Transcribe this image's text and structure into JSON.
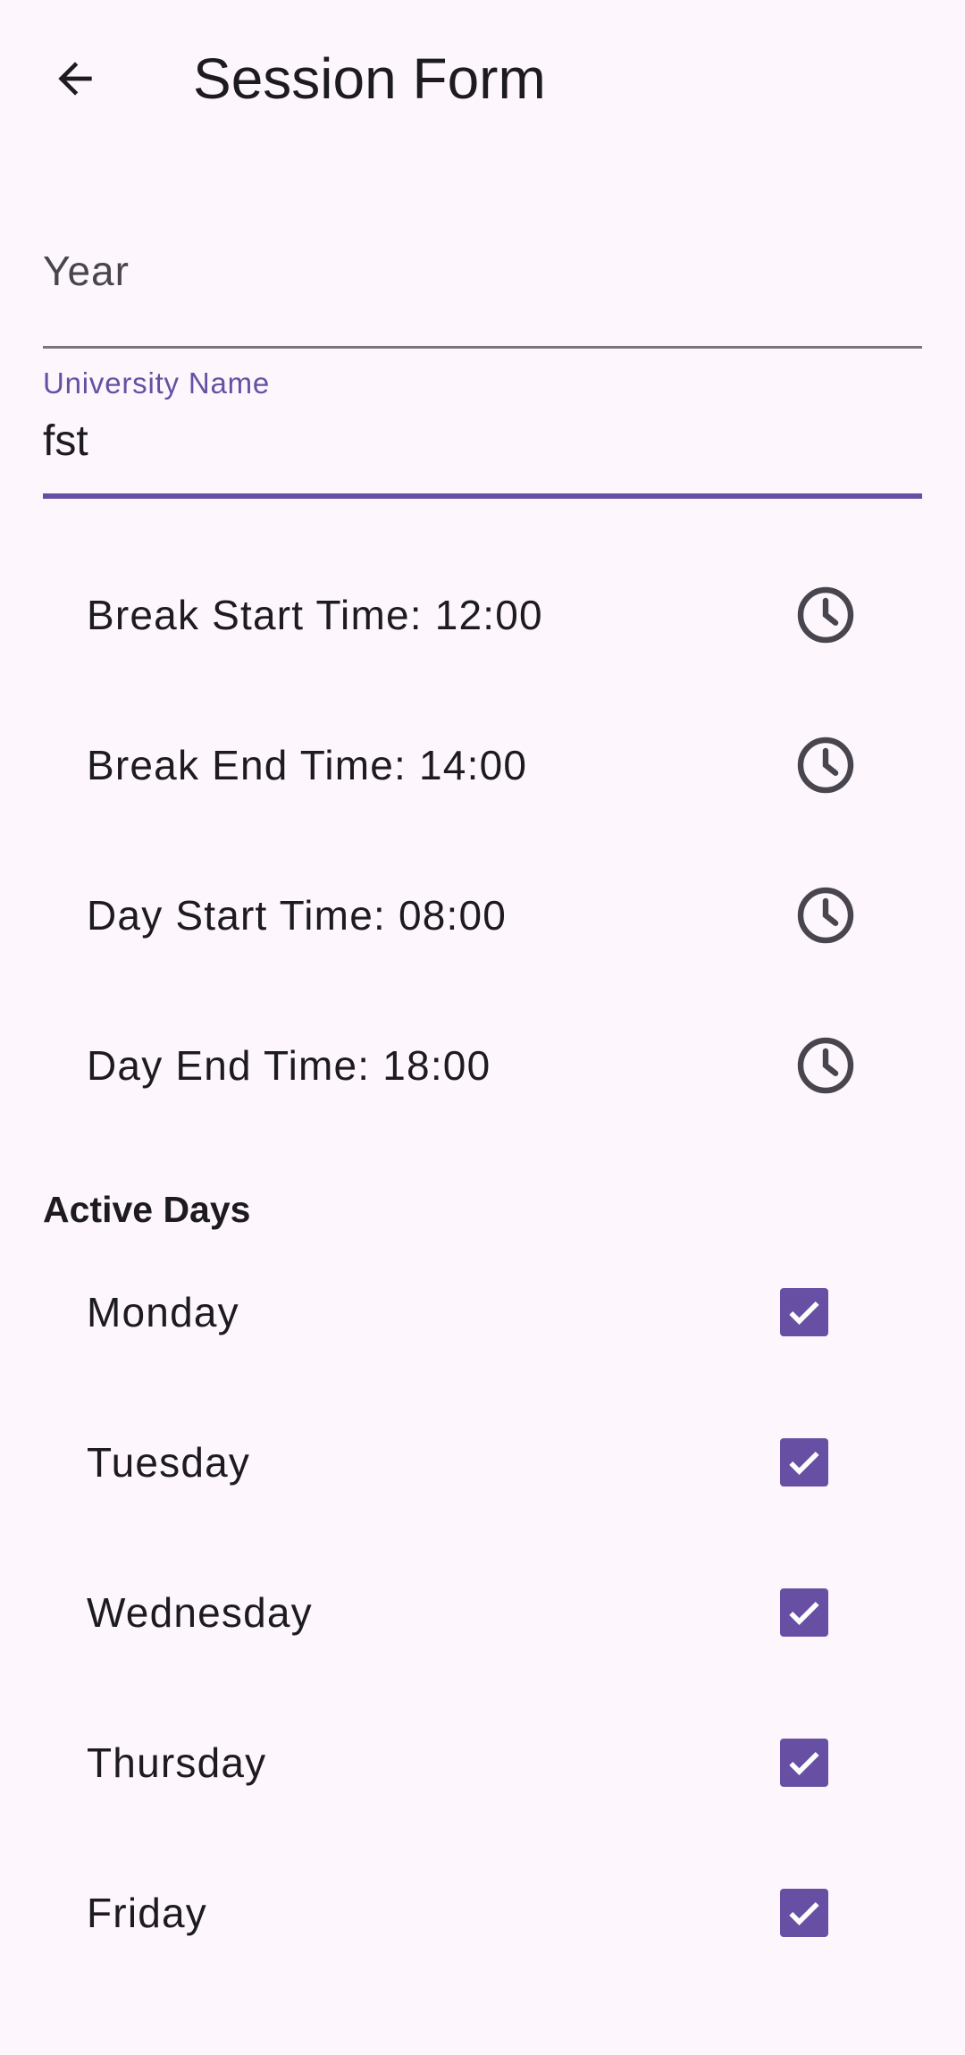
{
  "appbar": {
    "title": "Session Form",
    "back_icon": "arrow-back-icon"
  },
  "form": {
    "year": {
      "placeholder": "Year",
      "value": ""
    },
    "university": {
      "label": "University Name",
      "value": "fst"
    }
  },
  "times": [
    {
      "label": "Break Start Time: 12:00",
      "icon": "clock-icon"
    },
    {
      "label": "Break End Time: 14:00",
      "icon": "clock-icon"
    },
    {
      "label": "Day Start Time: 08:00",
      "icon": "clock-icon"
    },
    {
      "label": "Day End Time: 18:00",
      "icon": "clock-icon"
    }
  ],
  "active_days": {
    "title": "Active Days",
    "days": [
      {
        "label": "Monday",
        "checked": true
      },
      {
        "label": "Tuesday",
        "checked": true
      },
      {
        "label": "Wednesday",
        "checked": true
      },
      {
        "label": "Thursday",
        "checked": true
      },
      {
        "label": "Friday",
        "checked": true
      }
    ]
  },
  "colors": {
    "background": "#fdf7fd",
    "primary": "#6750a4",
    "on_surface": "#1d1b20",
    "outline": "#79747e"
  }
}
